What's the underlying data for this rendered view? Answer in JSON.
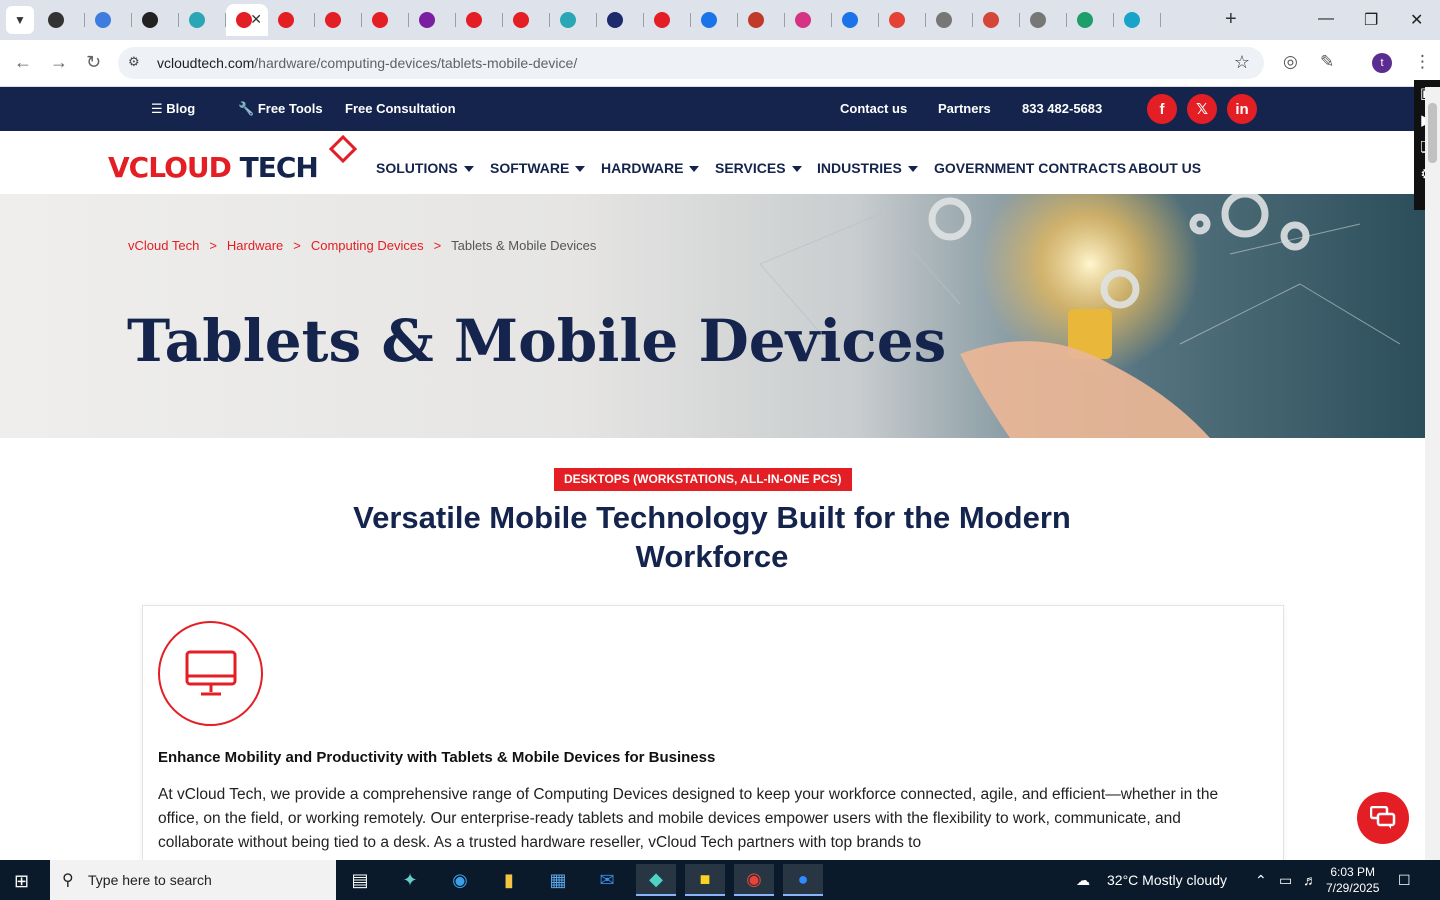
{
  "browser": {
    "tab_favicons": [
      "#333333",
      "#3f7ce0",
      "#222222",
      "#2aa6b5",
      "#e31e24",
      "#e31e24",
      "#e31e24",
      "#e31e24",
      "#7a1fa2",
      "#e31e24",
      "#e31e24",
      "#2aa6b5",
      "#1d2b6e",
      "#e31e24",
      "#1a73e8",
      "#c0392b",
      "#d63384",
      "#1a73e8",
      "#e34234",
      "#777777",
      "#d44638",
      "#777777",
      "#1e9e6a",
      "#1aa3c9"
    ],
    "url_domain": "vcloudtech.com",
    "url_path": "/hardware/computing-devices/tablets-mobile-device/",
    "profile_initial": "t"
  },
  "topbar": {
    "blog": "Blog",
    "free_tools": "Free Tools",
    "free_consultation": "Free Consultation",
    "contact": "Contact us",
    "partners": "Partners",
    "phone": "833 482-5683"
  },
  "logo": {
    "v": "V",
    "cloud": "CLOUD",
    "tech": " TECH"
  },
  "nav": {
    "solutions": "SOLUTIONS",
    "software": "SOFTWARE",
    "hardware": "HARDWARE",
    "services": "SERVICES",
    "industries": "INDUSTRIES",
    "government": "GOVERNMENT CONTRACTS",
    "about": "ABOUT US"
  },
  "breadcrumb": {
    "home": "vCloud Tech",
    "hardware": "Hardware",
    "computing": "Computing Devices",
    "current": "Tablets & Mobile Devices",
    "separator": ">"
  },
  "hero": {
    "title": "Tablets & Mobile Devices"
  },
  "section": {
    "tag": "DESKTOPS (WORKSTATIONS, ALL-IN-ONE PCS)",
    "title": "Versatile Mobile Technology Built for the Modern Workforce"
  },
  "card": {
    "heading": "Enhance Mobility and Productivity with Tablets & Mobile Devices for Business",
    "body": "At vCloud Tech, we provide a comprehensive range of Computing Devices designed to keep your workforce connected, agile, and efficient—whether in the office, on the field, or working remotely. Our enterprise-ready tablets and mobile devices empower users with the flexibility to work, communicate, and collaborate without being tied to a desk. As a trusted hardware reseller, vCloud Tech partners with top brands to"
  },
  "taskbar": {
    "search_placeholder": "Type here to search",
    "weather": "32°C  Mostly cloudy",
    "time": "6:03 PM",
    "date": "7/29/2025"
  },
  "colors": {
    "brand_red": "#e31e24",
    "navy": "#14244d"
  }
}
